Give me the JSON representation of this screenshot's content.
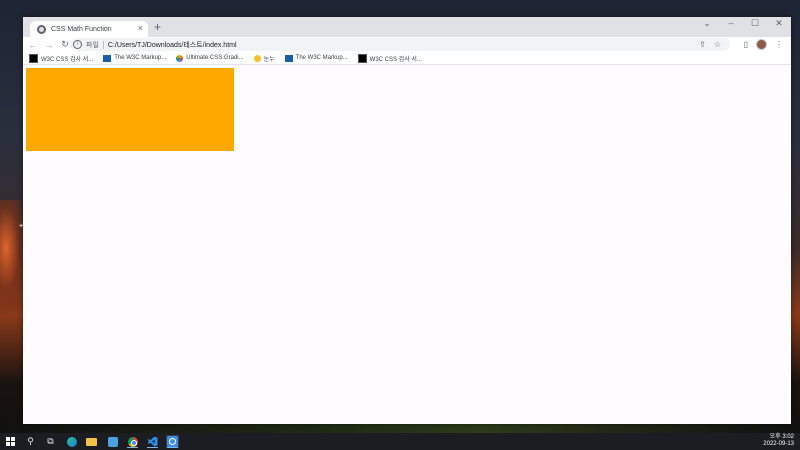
{
  "browser": {
    "tab": {
      "title": "CSS Math Function",
      "close": "×"
    },
    "new_tab": "+",
    "window_controls": {
      "chevron": "⌄",
      "minimize": "–",
      "maximize": "☐",
      "close": "✕"
    },
    "nav": {
      "back": "←",
      "forward": "→",
      "reload": "↻"
    },
    "address": {
      "scheme_label": "파일",
      "url": "C:/Users/TJ/Downloads/테스트/index.html"
    },
    "bookmarks": [
      {
        "label": "W3C CSS 검사 서...",
        "icon": "w3c-icon"
      },
      {
        "label": "The W3C Markup...",
        "icon": "w3c-blue-icon"
      },
      {
        "label": "Ultimate CSS Gradi...",
        "icon": "gradient-icon"
      },
      {
        "label": "눈누",
        "icon": "noonnu-icon"
      },
      {
        "label": "The W3C Markup...",
        "icon": "w3c-text-icon"
      },
      {
        "label": "W3C CSS 검사 서...",
        "icon": "w3c-icon"
      }
    ]
  },
  "page": {
    "box_color": "#ffa800"
  },
  "taskbar": {
    "time": "오후 3:02",
    "date": "2022-09-13"
  }
}
